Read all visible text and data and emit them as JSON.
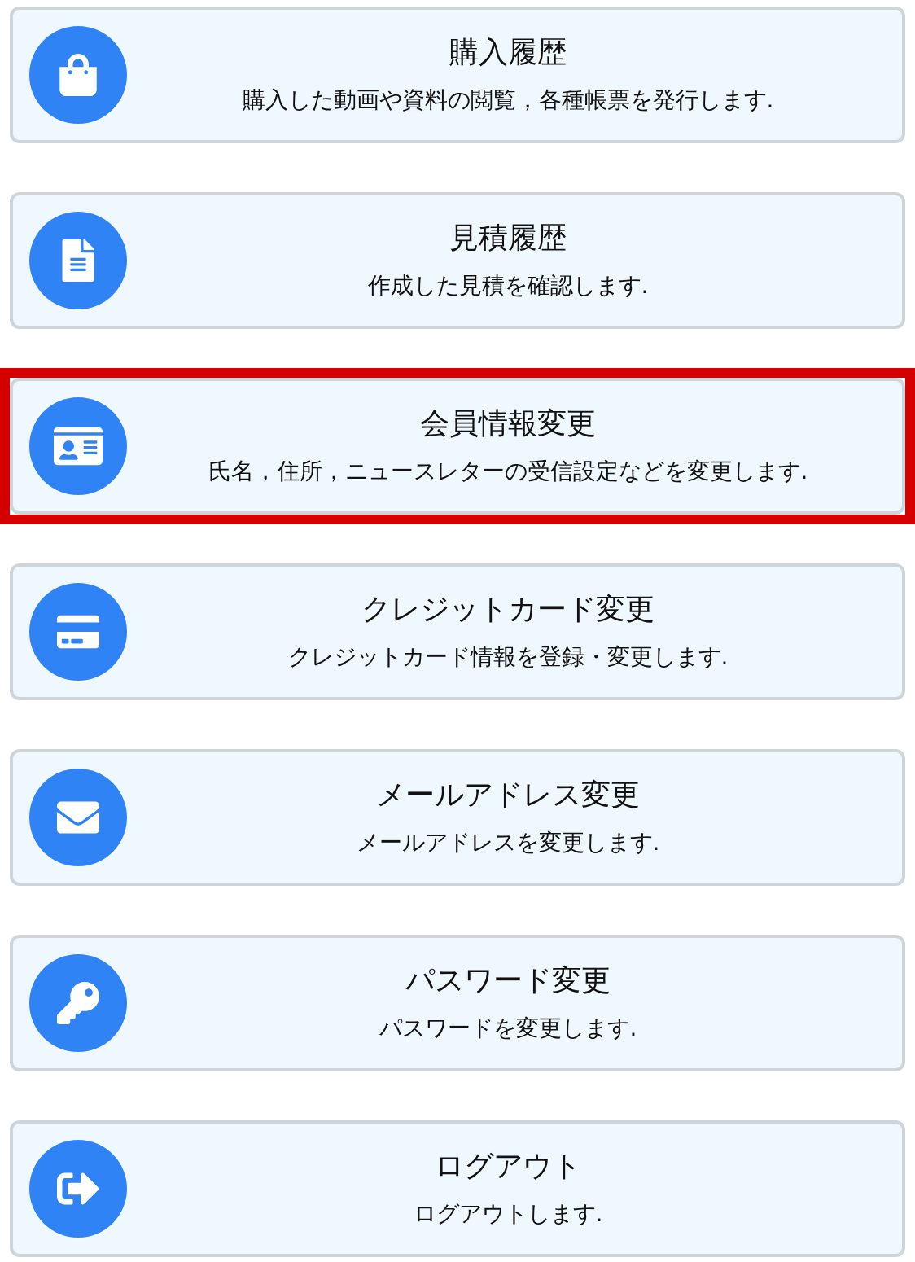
{
  "menu_items": [
    {
      "title": "購入履歴",
      "description": "購入した動画や資料の閲覧，各種帳票を発行します.",
      "highlighted": false
    },
    {
      "title": "見積履歴",
      "description": "作成した見積を確認します.",
      "highlighted": false
    },
    {
      "title": "会員情報変更",
      "description": "氏名，住所，ニュースレターの受信設定などを変更します.",
      "highlighted": true
    },
    {
      "title": "クレジットカード変更",
      "description": "クレジットカード情報を登録・変更します.",
      "highlighted": false
    },
    {
      "title": "メールアドレス変更",
      "description": "メールアドレスを変更します.",
      "highlighted": false
    },
    {
      "title": "パスワード変更",
      "description": "パスワードを変更します.",
      "highlighted": false
    },
    {
      "title": "ログアウト",
      "description": "ログアウトします.",
      "highlighted": false
    }
  ]
}
